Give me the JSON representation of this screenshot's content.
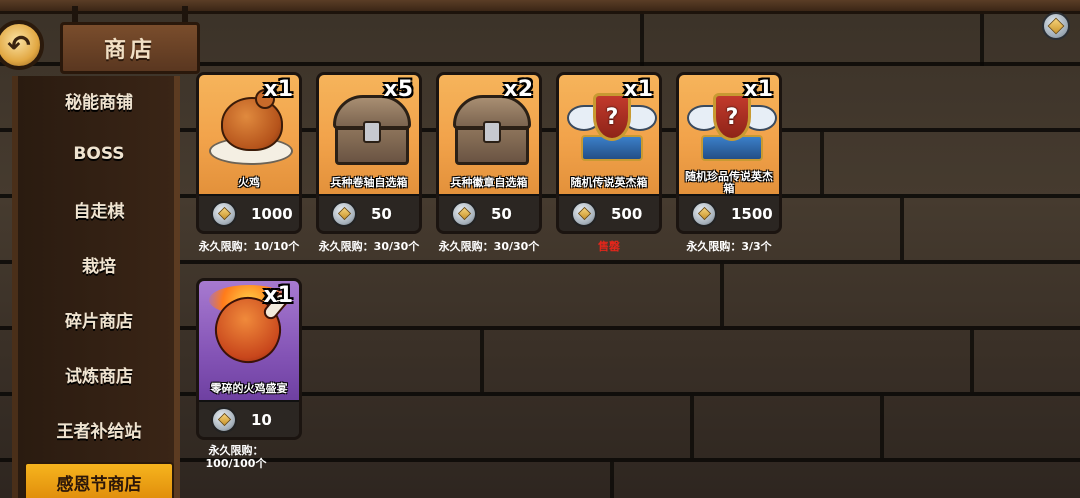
{
  "header": {
    "title": "商店",
    "back_icon": "↶"
  },
  "sidebar": {
    "items": [
      {
        "label": "秘能商铺"
      },
      {
        "label": "BOSS"
      },
      {
        "label": "自走棋"
      },
      {
        "label": "栽培"
      },
      {
        "label": "碎片商店"
      },
      {
        "label": "试炼商店"
      },
      {
        "label": "王者补给站"
      },
      {
        "label": "感恩节商店",
        "active": true
      }
    ]
  },
  "shop": {
    "items": [
      {
        "name": "火鸡",
        "count": "x1",
        "price": "1000",
        "limit": "永久限购：10/10个",
        "icon": "roast-turkey-icon"
      },
      {
        "name": "兵种卷轴自选箱",
        "count": "x5",
        "price": "50",
        "limit": "永久限购：30/30个",
        "icon": "treasure-chest-icon"
      },
      {
        "name": "兵种徽章自选箱",
        "count": "x2",
        "price": "50",
        "limit": "永久限购：30/30个",
        "icon": "treasure-chest-icon"
      },
      {
        "name": "随机传说英杰箱",
        "count": "x1",
        "price": "500",
        "limit": "售罄",
        "icon": "winged-crest-icon"
      },
      {
        "name": "随机珍品传说英杰箱",
        "count": "x1",
        "price": "1500",
        "limit": "永久限购：3/3个",
        "icon": "winged-crest-icon"
      },
      {
        "name": "零碎的火鸡盛宴",
        "count": "x1",
        "price": "10",
        "limit": "永久限购：100/100个",
        "icon": "flaming-drumstick-icon"
      }
    ]
  },
  "colors": {
    "active_tab": "#f6b41e",
    "card_orange": "#f6b45b",
    "card_purple": "#a77ad0",
    "soldout": "#e3261b"
  }
}
